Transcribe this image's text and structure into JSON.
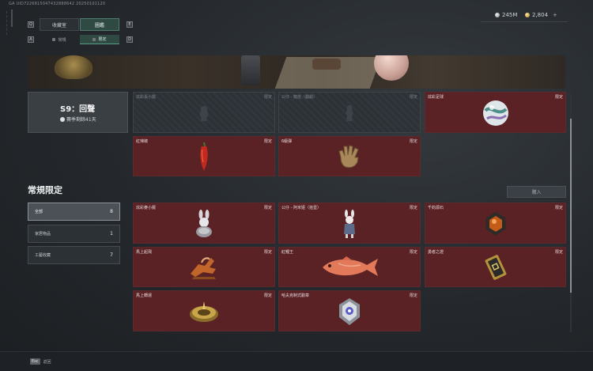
{
  "header": {
    "uid": "GA UID7226815047432888642 20250101120",
    "currency": [
      {
        "icon": "silver-coin-icon",
        "value": "245M"
      },
      {
        "icon": "gold-coin-icon",
        "value": "2,804"
      }
    ],
    "plus": "+"
  },
  "tabs": {
    "key_left": "Q",
    "key_right": "E",
    "main": [
      {
        "label": "收藏室",
        "active": false
      },
      {
        "label": "圖鑑",
        "active": true
      }
    ],
    "sub_key_left": "A",
    "sub_key_right": "D",
    "sub": [
      {
        "label": "常規",
        "active": false
      },
      {
        "label": "限定",
        "active": true
      }
    ]
  },
  "season": {
    "title": "S9：回聲",
    "remaining": "賽季剩餘41天"
  },
  "season_cards": [
    {
      "name": "炫彩長小擺",
      "tag": "限定",
      "locked": true,
      "icon": "locked-silhouette-icon"
    },
    {
      "name": "公仔 - 龍焰（戲劇）",
      "tag": "限定",
      "locked": true,
      "icon": "locked-silhouette-icon"
    },
    {
      "name": "炫彩足球",
      "tag": "限定",
      "locked": false,
      "icon": "marble-ball-icon"
    },
    {
      "name": "紅辣椒",
      "tag": "限定",
      "locked": false,
      "icon": "red-pepper-icon"
    },
    {
      "name": "6級彈",
      "tag": "限定",
      "locked": false,
      "icon": "glove-icon"
    }
  ],
  "section": {
    "title": "常規限定",
    "buy_label": "購入"
  },
  "filters": [
    {
      "label": "全部",
      "count": "8",
      "active": true
    },
    {
      "label": "家居物品",
      "count": "1",
      "active": false
    },
    {
      "label": "工藝收藏",
      "count": "7",
      "active": false
    }
  ],
  "regular_cards": [
    {
      "name": "炫彩麥小擺",
      "tag": "限定",
      "icon": "bunny-figurine-icon"
    },
    {
      "name": "公仔 - 阿米娅（拾壹）",
      "tag": "限定",
      "icon": "bunny-figure-icon"
    },
    {
      "name": "千鈞源石",
      "tag": "限定",
      "icon": "amber-stone-icon"
    },
    {
      "name": "馬上起飛",
      "tag": "限定",
      "icon": "flying-horse-icon"
    },
    {
      "name": "紅鯉王",
      "tag": "限定",
      "icon": "carp-fish-icon"
    },
    {
      "name": "勇者之證",
      "tag": "限定",
      "icon": "golden-plaque-icon"
    },
    {
      "name": "馬上轉運",
      "tag": "限定",
      "icon": "compass-icon"
    },
    {
      "name": "哈夫克制式勳章",
      "tag": "限定",
      "icon": "medal-badge-icon"
    }
  ],
  "footer": {
    "key": "Esc",
    "label": "返回"
  },
  "colors": {
    "card_bg": "#5b2226",
    "tab_active": "#2f4a42",
    "background": "#24282c"
  }
}
